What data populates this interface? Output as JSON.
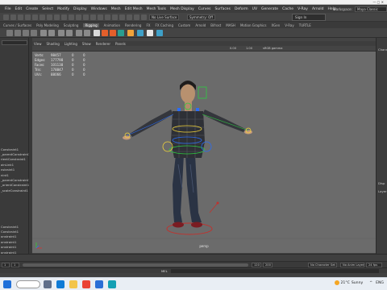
{
  "menubar": {
    "items": [
      "File",
      "Edit",
      "Create",
      "Select",
      "Modify",
      "Display",
      "Windows",
      "Mesh",
      "Edit Mesh",
      "Mesh Tools",
      "Mesh Display",
      "Curves",
      "Surfaces",
      "Deform",
      "UV",
      "Generate",
      "Cache",
      "V-Ray",
      "Arnold",
      "Help"
    ],
    "workspace_label": "Workspace:",
    "workspace_value": "Maya Classic",
    "live_surface": "No Live Surface",
    "symmetry": "Symmetry: Off",
    "sign_in": "Sign In"
  },
  "shelf_tabs": {
    "items": [
      "Curves / Surfaces",
      "Poly Modeling",
      "Sculpting",
      "Rigging",
      "Animation",
      "Rendering",
      "FX",
      "FX Caching",
      "Custom",
      "Arnold",
      "Bifrost",
      "MASH",
      "Motion Graphics",
      "XGen",
      "V-Ray",
      "TURTLE"
    ],
    "active_index": 3
  },
  "panel_menu": {
    "items": [
      "View",
      "Shading",
      "Lighting",
      "Show",
      "Renderer",
      "Panels"
    ]
  },
  "hud": {
    "rows": [
      {
        "label": "Verts:",
        "value": "98457",
        "a": "0",
        "b": "0"
      },
      {
        "label": "Edges:",
        "value": "177798",
        "a": "0",
        "b": "0"
      },
      {
        "label": "Faces:",
        "value": "101138",
        "a": "0",
        "b": "0"
      },
      {
        "label": "Tris:",
        "value": "178847",
        "a": "0",
        "b": "0"
      },
      {
        "label": "UVs:",
        "value": "88066",
        "a": "0",
        "b": "0"
      }
    ]
  },
  "viewport": {
    "camera_label": "persp",
    "exposure": "0.00",
    "gamma": "1.00",
    "color_management": "sRGB gamma"
  },
  "outliner": {
    "rows": [
      "",
      "",
      "",
      "",
      "",
      "",
      "",
      "",
      "",
      "",
      "",
      "",
      "",
      "",
      "",
      "",
      "",
      "",
      "",
      "Constraint1",
      "_parentConstraint1",
      "rientConstraint1",
      "ainLink1",
      "nstraint1",
      "nint1",
      "_parentConstraint1",
      "_orientConstraint1",
      "_scaleConstraint1",
      "",
      "",
      "",
      "",
      "",
      "",
      "Constraint1",
      "Constraint1",
      "onstraint1",
      "onstraint1",
      "onstraint1",
      "onstraint1"
    ]
  },
  "right_panel": {
    "labels": [
      "Chann",
      "Disp",
      "Layer"
    ]
  },
  "range": {
    "start": "1",
    "end": "120",
    "anim_end": "200",
    "character_set": "No Character Set",
    "anim_layer": "No Anim Layer",
    "fps": "24 fps"
  },
  "cmdline": {
    "label": "MEL"
  },
  "taskbar": {
    "temperature": "21°C",
    "weather": "Sunny",
    "language": "ENG",
    "time": "",
    "colors": {
      "start": "#1e6fd9",
      "search": "#ffffff",
      "taskview": "#5e6e8a",
      "edge": "#0f7bd6",
      "explorer": "#f3c54a",
      "chrome": "#ea4335",
      "store": "#2b6fd6",
      "maya": "#14a0b4"
    }
  }
}
